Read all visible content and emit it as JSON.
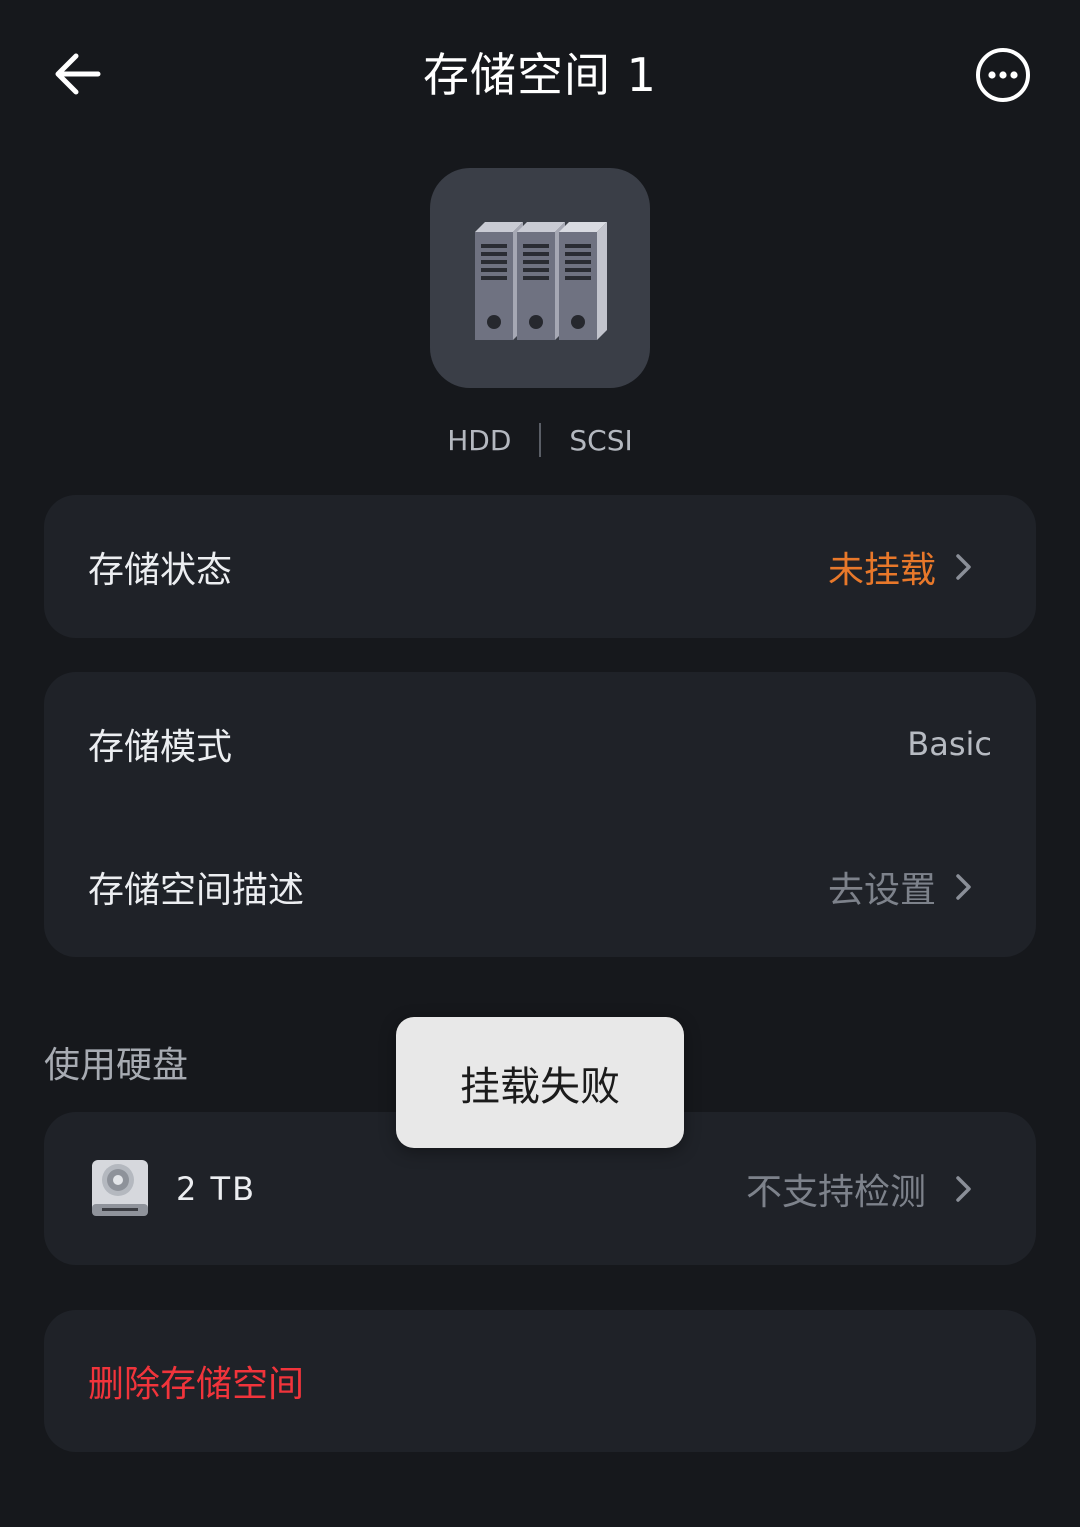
{
  "header": {
    "title": "存储空间 1",
    "back_icon": "arrow-left-icon",
    "more_icon": "more-dots-icon"
  },
  "device": {
    "icon": "storage-cabinet-icon",
    "tags": [
      "HDD",
      "SCSI"
    ]
  },
  "status_card": {
    "label": "存储状态",
    "value": "未挂载",
    "value_color": "#e8782a"
  },
  "info_card": {
    "mode_label": "存储模式",
    "mode_value": "Basic",
    "desc_label": "存储空间描述",
    "desc_value": "去设置"
  },
  "disks": {
    "section_title": "使用硬盘",
    "items": [
      {
        "icon": "hard-disk-icon",
        "size": "2 TB",
        "status": "不支持检测"
      }
    ]
  },
  "actions": {
    "delete_label": "删除存储空间",
    "delete_color": "#f1343b"
  },
  "toast": {
    "message": "挂载失败"
  }
}
